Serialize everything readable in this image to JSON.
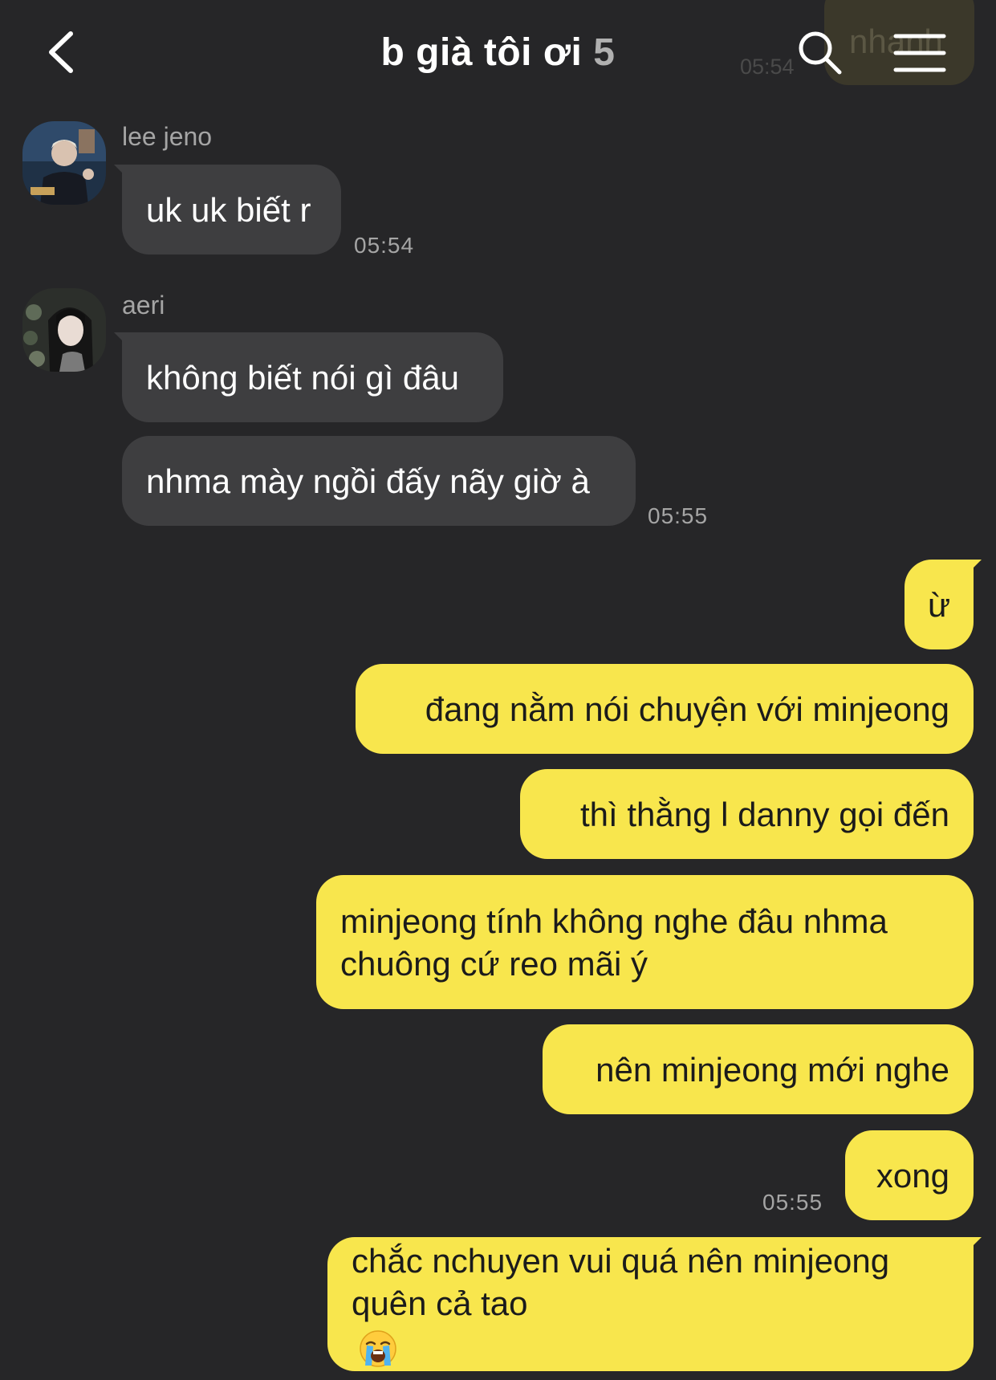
{
  "header": {
    "title": "b già tôi ơi",
    "member_count": "5"
  },
  "ghost": {
    "text": "nhanh",
    "time": "05:54"
  },
  "messages": {
    "jeno": {
      "sender": "lee jeno",
      "text": "uk uk biết r",
      "time": "05:54"
    },
    "aeri": {
      "sender": "aeri",
      "text1": "không biết nói gì đâu",
      "text2": "nhma mày ngồi đấy nãy giờ à",
      "time": "05:55"
    },
    "me": {
      "m1": "ừ",
      "m2": "đang nằm nói chuyện với minjeong",
      "m3": "thì thằng l danny gọi đến",
      "m4_line1": "minjeong tính không nghe đâu nhma",
      "m4_line2": "chuông cứ reo mãi ý",
      "m5": "nên minjeong mới nghe",
      "m6": "xong",
      "time": "05:55",
      "m7_line1": "chắc nchuyen vui quá nên minjeong",
      "m7_line2": "quên cả tao"
    }
  },
  "icons": {
    "back": "chevron-left-icon",
    "search": "search-icon",
    "menu": "hamburger-menu-icon",
    "emoji": "loudly-crying-face-emoji"
  },
  "colors": {
    "background": "#262628",
    "incoming_bubble": "#3e3e40",
    "outgoing_bubble": "#f8e64d"
  }
}
